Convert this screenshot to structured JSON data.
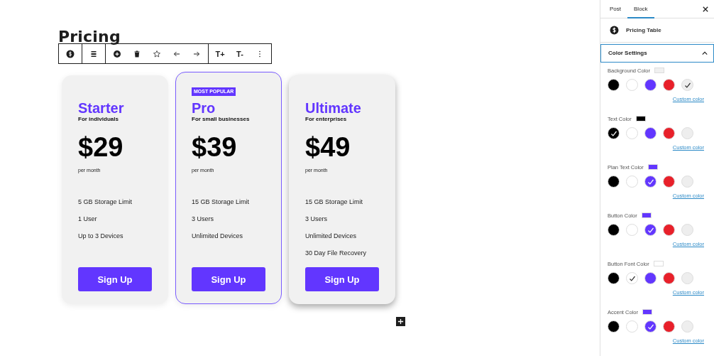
{
  "editor": {
    "heading": "Pricing",
    "toolbar": {
      "text_buttons": [
        "T+",
        "T-"
      ]
    },
    "cards": [
      {
        "title": "Starter",
        "subtitle": "For individuals",
        "price": "$29",
        "period": "per month",
        "features": [
          "5 GB Storage Limit",
          "1 User",
          "Up to 3 Devices"
        ],
        "button": "Sign Up",
        "selected": false,
        "raised": false
      },
      {
        "badge": "MOST POPULAR",
        "title": "Pro",
        "subtitle": "For small businesses",
        "price": "$39",
        "period": "per month",
        "features": [
          "15 GB Storage Limit",
          "3 Users",
          "Unlimited Devices"
        ],
        "button": "Sign Up",
        "selected": true,
        "raised": false
      },
      {
        "title": "Ultimate",
        "subtitle": "For enterprises",
        "price": "$49",
        "period": "per month",
        "features": [
          "15 GB Storage Limit",
          "3 Users",
          "Unlimited Devices",
          "30 Day File Recovery"
        ],
        "button": "Sign Up",
        "selected": false,
        "raised": true
      }
    ]
  },
  "sidebar": {
    "tabs": [
      {
        "label": "Post",
        "selected": false
      },
      {
        "label": "Block",
        "selected": true
      }
    ],
    "block_name": "Pricing Table",
    "panel": {
      "title": "Color Settings",
      "expanded": true,
      "groups": [
        {
          "label": "Background Color",
          "color": "#f0f0f0",
          "link": "Custom color",
          "swatches": [
            {
              "color": "#000000",
              "selected": false
            },
            {
              "color": "#ffffff",
              "selected": false
            },
            {
              "color": "#6236ff",
              "selected": false
            },
            {
              "color": "#e8202a",
              "selected": false
            },
            {
              "color": "#eeeeee",
              "selected": true
            }
          ]
        },
        {
          "label": "Text Color",
          "color": "#000000",
          "link": "Custom color",
          "swatches": [
            {
              "color": "#000000",
              "selected": true
            },
            {
              "color": "#ffffff",
              "selected": false
            },
            {
              "color": "#6236ff",
              "selected": false
            },
            {
              "color": "#e8202a",
              "selected": false
            },
            {
              "color": "#eeeeee",
              "selected": false
            }
          ]
        },
        {
          "label": "Plan Text Color",
          "color": "#6236ff",
          "link": "Custom color",
          "swatches": [
            {
              "color": "#000000",
              "selected": false
            },
            {
              "color": "#ffffff",
              "selected": false
            },
            {
              "color": "#6236ff",
              "selected": true
            },
            {
              "color": "#e8202a",
              "selected": false
            },
            {
              "color": "#eeeeee",
              "selected": false
            }
          ]
        },
        {
          "label": "Button Color",
          "color": "#6236ff",
          "link": "Custom color",
          "swatches": [
            {
              "color": "#000000",
              "selected": false
            },
            {
              "color": "#ffffff",
              "selected": false
            },
            {
              "color": "#6236ff",
              "selected": true
            },
            {
              "color": "#e8202a",
              "selected": false
            },
            {
              "color": "#eeeeee",
              "selected": false
            }
          ]
        },
        {
          "label": "Button Font Color",
          "color": "#ffffff",
          "link": "Custom color",
          "swatches": [
            {
              "color": "#000000",
              "selected": false
            },
            {
              "color": "#ffffff",
              "selected": true
            },
            {
              "color": "#6236ff",
              "selected": false
            },
            {
              "color": "#e8202a",
              "selected": false
            },
            {
              "color": "#eeeeee",
              "selected": false
            }
          ]
        },
        {
          "label": "Accent Color",
          "color": "#6236ff",
          "link": "Custom color",
          "swatches": [
            {
              "color": "#000000",
              "selected": false
            },
            {
              "color": "#ffffff",
              "selected": false
            },
            {
              "color": "#6236ff",
              "selected": true
            },
            {
              "color": "#e8202a",
              "selected": false
            },
            {
              "color": "#eeeeee",
              "selected": false
            }
          ]
        }
      ]
    }
  }
}
